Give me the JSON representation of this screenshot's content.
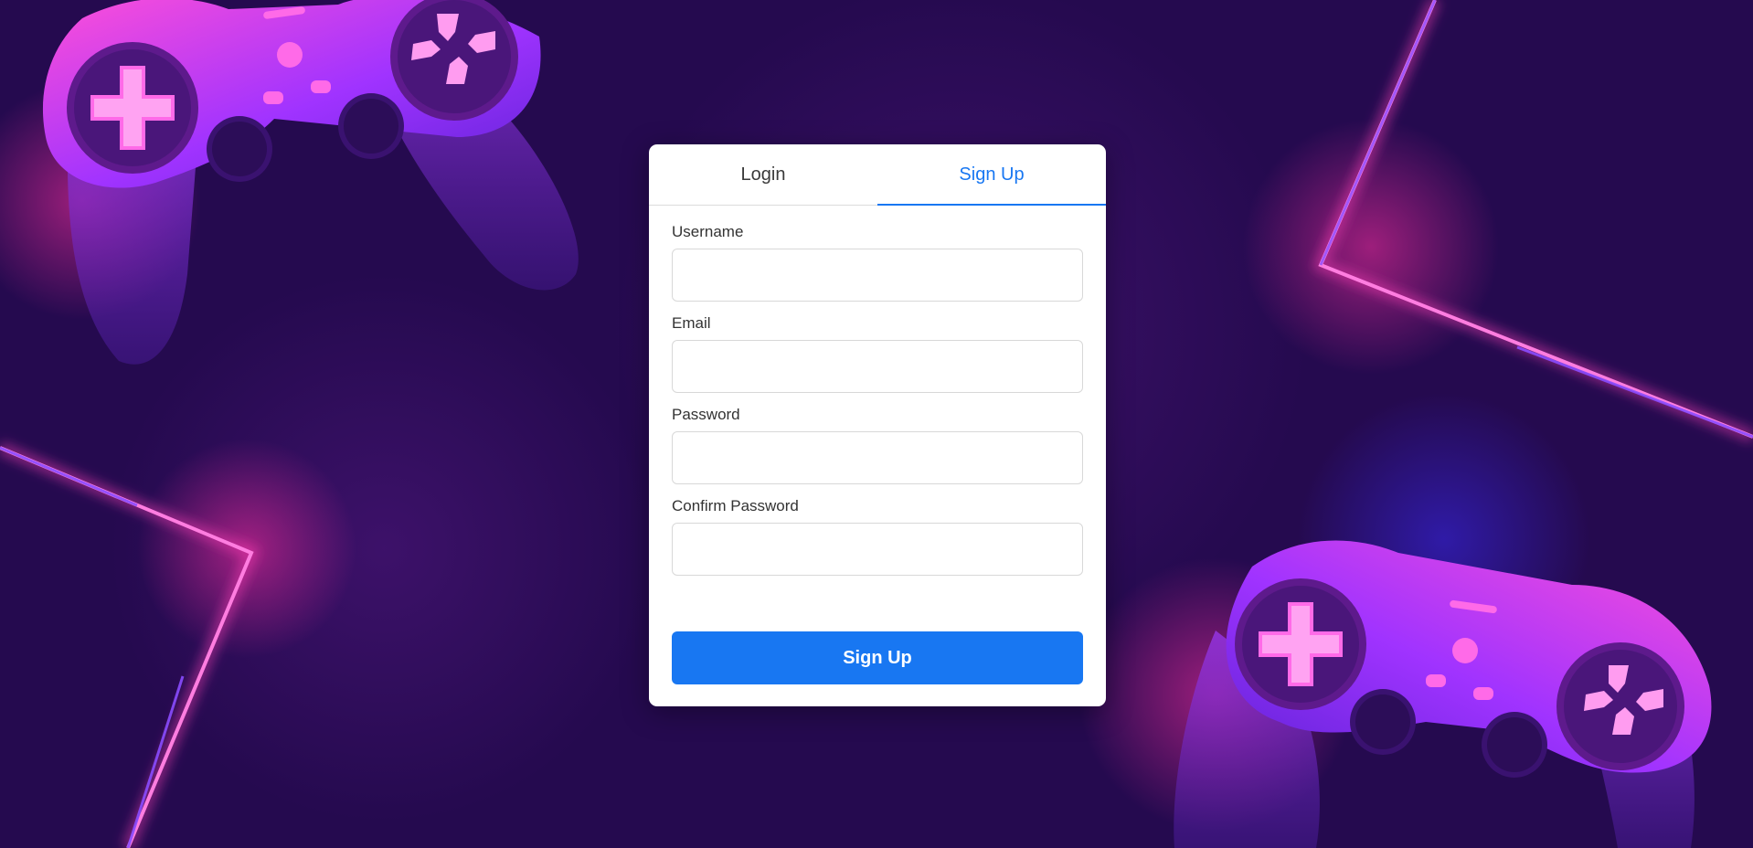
{
  "tabs": {
    "login_label": "Login",
    "signup_label": "Sign Up",
    "active": "Sign Up"
  },
  "form": {
    "username_label": "Username",
    "email_label": "Email",
    "password_label": "Password",
    "confirm_password_label": "Confirm Password",
    "username_value": "",
    "email_value": "",
    "password_value": "",
    "confirm_password_value": "",
    "submit_label": "Sign Up"
  },
  "colors": {
    "background": "#250a4f",
    "accent": "#1877f2",
    "neon_pink": "#ff3fb8",
    "neon_purple": "#7c3cff"
  }
}
